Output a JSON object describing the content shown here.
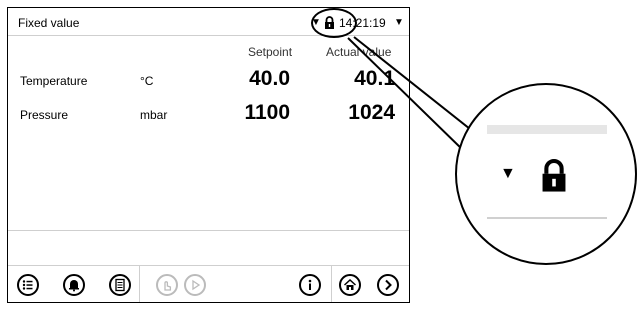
{
  "header": {
    "mode_label": "Fixed value",
    "time": "14:21:19",
    "arrow_glyph": "▼",
    "lock_icon": "lock-icon"
  },
  "columns": {
    "setpoint": "Setpoint",
    "actual": "Actual value"
  },
  "rows": [
    {
      "name": "Temperature",
      "unit": "°C",
      "setpoint": "40.0",
      "actual": "40.1"
    },
    {
      "name": "Pressure",
      "unit": "mbar",
      "setpoint": "1100",
      "actual": "1024"
    }
  ],
  "toolbar": {
    "icons": [
      "list-icon",
      "alarm-bell-icon",
      "notes-icon",
      "touch-icon",
      "play-icon",
      "info-icon",
      "home-icon",
      "next-icon"
    ]
  },
  "callout": {
    "arrow_glyph": "▼",
    "lock_icon": "lock-icon"
  }
}
